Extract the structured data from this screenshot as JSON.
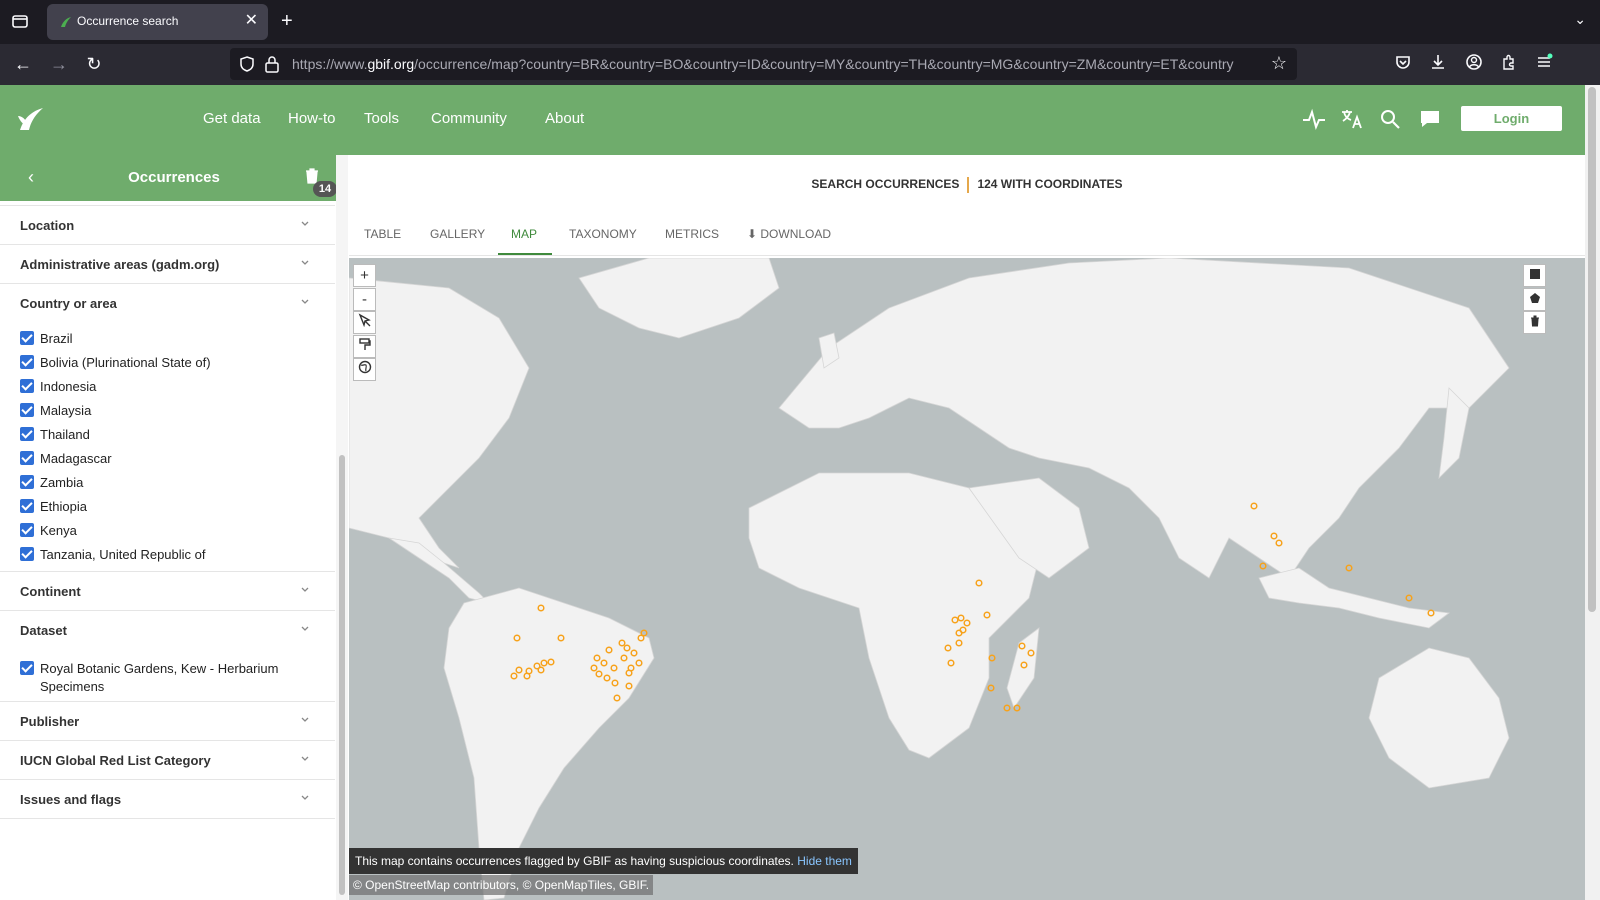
{
  "browser": {
    "tab_title": "Occurrence search",
    "url_prefix": "https://www.",
    "url_domain": "gbif.org",
    "url_rest": "/occurrence/map?country=BR&country=BO&country=ID&country=MY&country=TH&country=MG&country=ZM&country=ET&country"
  },
  "header": {
    "menu": [
      "Get data",
      "How-to",
      "Tools",
      "Community",
      "About"
    ],
    "login_label": "Login"
  },
  "sidebar": {
    "title": "Occurrences",
    "filter_count": "14",
    "facets": {
      "location": "Location",
      "admin_areas": "Administrative areas (gadm.org)",
      "country": "Country or area",
      "continent": "Continent",
      "dataset": "Dataset",
      "publisher": "Publisher",
      "iucn": "IUCN Global Red List Category",
      "issues": "Issues and flags"
    },
    "countries": [
      "Brazil",
      "Bolivia (Plurinational State of)",
      "Indonesia",
      "Malaysia",
      "Thailand",
      "Madagascar",
      "Zambia",
      "Ethiopia",
      "Kenya",
      "Tanzania, United Republic of"
    ],
    "dataset_line1": "Royal Botanic Gardens, Kew - Herbarium",
    "dataset_line2": "Specimens"
  },
  "main": {
    "summary_left": "SEARCH OCCURRENCES",
    "summary_right": "124 WITH COORDINATES",
    "tabs": [
      "TABLE",
      "GALLERY",
      "MAP",
      "TAXONOMY",
      "METRICS",
      "DOWNLOAD"
    ],
    "active_tab": "MAP"
  },
  "map": {
    "notice_text": "This map contains occurrences flagged by GBIF as having suspicious coordinates.",
    "notice_link": "Hide them",
    "attribution": "© OpenStreetMap contributors, © OpenMapTiles, GBIF.",
    "zoom_in": "+",
    "zoom_out": "-",
    "colors": {
      "water": "#b9c0c1",
      "land": "#f2f2f2",
      "point": "#f7a21b"
    }
  }
}
